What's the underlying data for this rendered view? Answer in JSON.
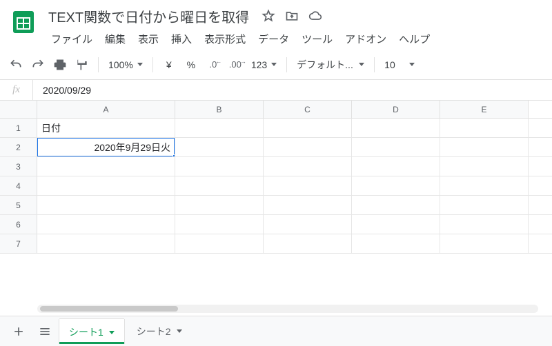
{
  "doc_title": "TEXT関数で日付から曜日を取得",
  "menus": [
    "ファイル",
    "編集",
    "表示",
    "挿入",
    "表示形式",
    "データ",
    "ツール",
    "アドオン",
    "ヘルプ"
  ],
  "toolbar": {
    "zoom": "100%",
    "currency": "¥",
    "percent": "%",
    "dec_dec": ".0",
    "dec_inc": ".00",
    "more_formats": "123",
    "font": "デフォルト...",
    "font_size": "10"
  },
  "formula_bar": {
    "label": "fx",
    "value": "2020/09/29"
  },
  "columns": [
    "A",
    "B",
    "C",
    "D",
    "E"
  ],
  "rows": [
    {
      "n": "1",
      "cells": {
        "A": "日付"
      }
    },
    {
      "n": "2",
      "cells": {
        "A": "2020年9月29日火"
      },
      "selected": "A",
      "A_align": "right"
    },
    {
      "n": "3",
      "cells": {}
    },
    {
      "n": "4",
      "cells": {}
    },
    {
      "n": "5",
      "cells": {}
    },
    {
      "n": "6",
      "cells": {}
    },
    {
      "n": "7",
      "cells": {}
    }
  ],
  "sheets": {
    "active": "シート1",
    "tabs": [
      "シート1",
      "シート2"
    ]
  }
}
